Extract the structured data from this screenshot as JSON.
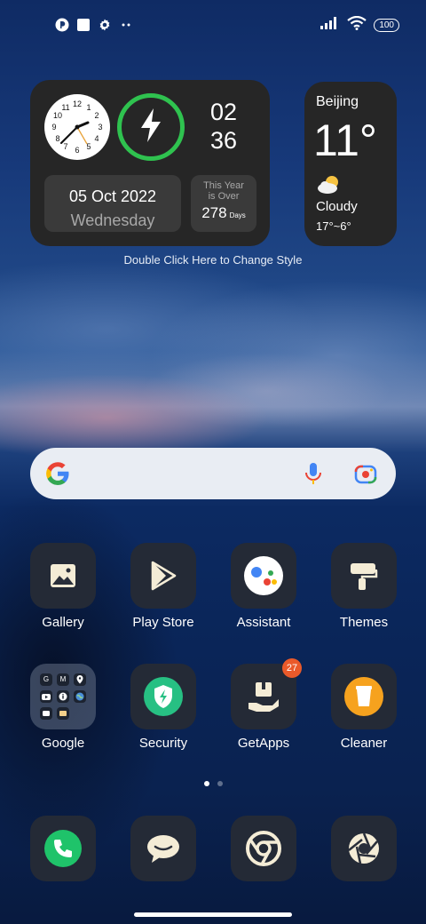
{
  "status_bar": {
    "battery": "100",
    "icons": [
      "notification-app-icon",
      "square-icon",
      "gear-icon",
      "more-dots-icon",
      "signal-icon",
      "wifi-icon",
      "battery-icon"
    ]
  },
  "clock_widget": {
    "hour": "02",
    "minute": "36",
    "date": "05 Oct 2022",
    "weekday": "Wednesday",
    "year_label_line1": "This Year",
    "year_label_line2": "is Over",
    "days_count": "278",
    "days_unit": "Days",
    "analog_numbers": [
      "12",
      "1",
      "2",
      "3",
      "4",
      "5",
      "6",
      "7",
      "8",
      "9",
      "10",
      "11"
    ]
  },
  "weather_widget": {
    "city": "Beijing",
    "temperature": "11°",
    "condition": "Cloudy",
    "range": "17°~6°"
  },
  "widget_hint": "Double Click Here to Change Style",
  "search": {
    "icons": [
      "google-logo-icon",
      "microphone-icon",
      "google-lens-icon"
    ]
  },
  "apps": {
    "row1": [
      {
        "label": "Gallery",
        "icon": "gallery-icon"
      },
      {
        "label": "Play Store",
        "icon": "play-store-icon"
      },
      {
        "label": "Assistant",
        "icon": "assistant-icon"
      },
      {
        "label": "Themes",
        "icon": "themes-icon"
      }
    ],
    "row2": [
      {
        "label": "Google",
        "icon": "google-folder-icon"
      },
      {
        "label": "Security",
        "icon": "security-icon"
      },
      {
        "label": "GetApps",
        "icon": "getapps-icon",
        "badge": "27"
      },
      {
        "label": "Cleaner",
        "icon": "cleaner-icon"
      }
    ]
  },
  "folder_apps": [
    "G",
    "M",
    "",
    "",
    "",
    "",
    "",
    "",
    ""
  ],
  "page_indicator": {
    "current": 1,
    "total": 2
  },
  "dock": [
    {
      "icon": "phone-icon"
    },
    {
      "icon": "messages-icon"
    },
    {
      "icon": "browser-icon"
    },
    {
      "icon": "camera-icon"
    }
  ],
  "colors": {
    "widget_bg": "#262626",
    "charge_ring": "#2fc24f",
    "badge": "#ea5a2a",
    "security_green": "#27c083",
    "cleaner_orange": "#f6a21e",
    "phone_green": "#1fc36a"
  }
}
